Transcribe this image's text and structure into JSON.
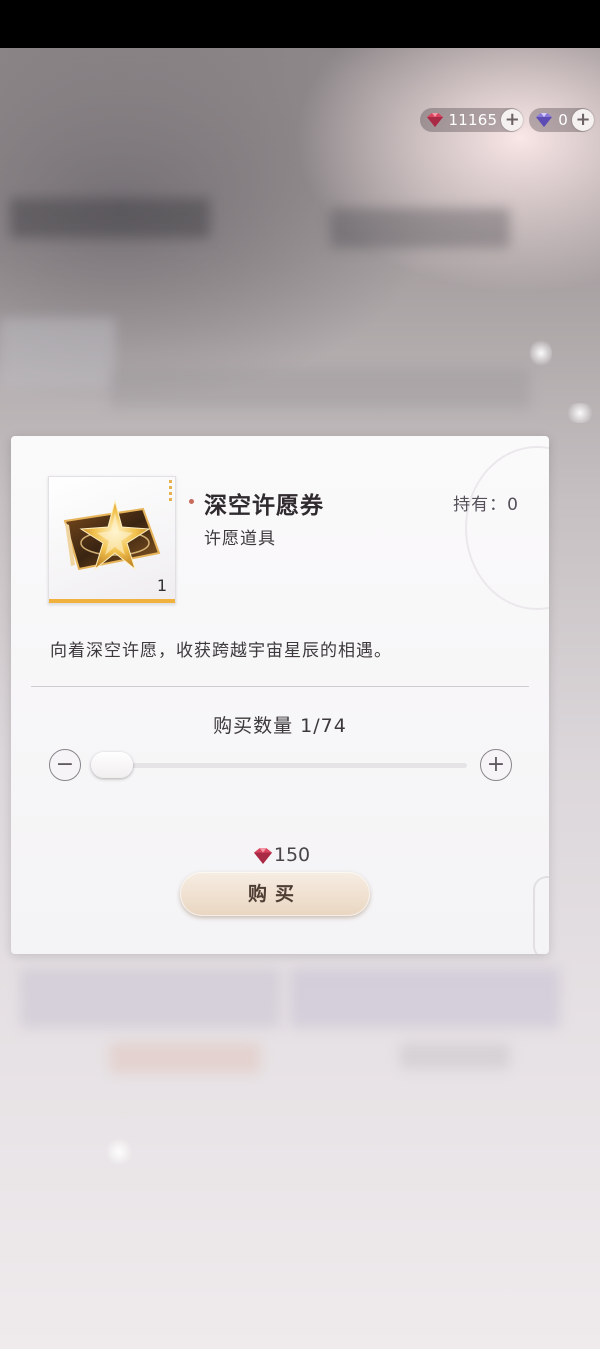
{
  "header": {
    "currencies": [
      {
        "icon": "red-gem-icon",
        "value": "11165"
      },
      {
        "icon": "purple-gem-icon",
        "value": "0"
      }
    ]
  },
  "item": {
    "name": "深空许愿券",
    "category": "许愿道具",
    "owned": "持有：0",
    "count": "1",
    "description": "向着深空许愿，收获跨越宇宙星辰的相遇。"
  },
  "purchase": {
    "quantity_label": "购买数量 1/74",
    "quantity_current": 1,
    "quantity_max": 74,
    "minus": "−",
    "plus": "+",
    "price": "150",
    "buy_label": "购买"
  }
}
